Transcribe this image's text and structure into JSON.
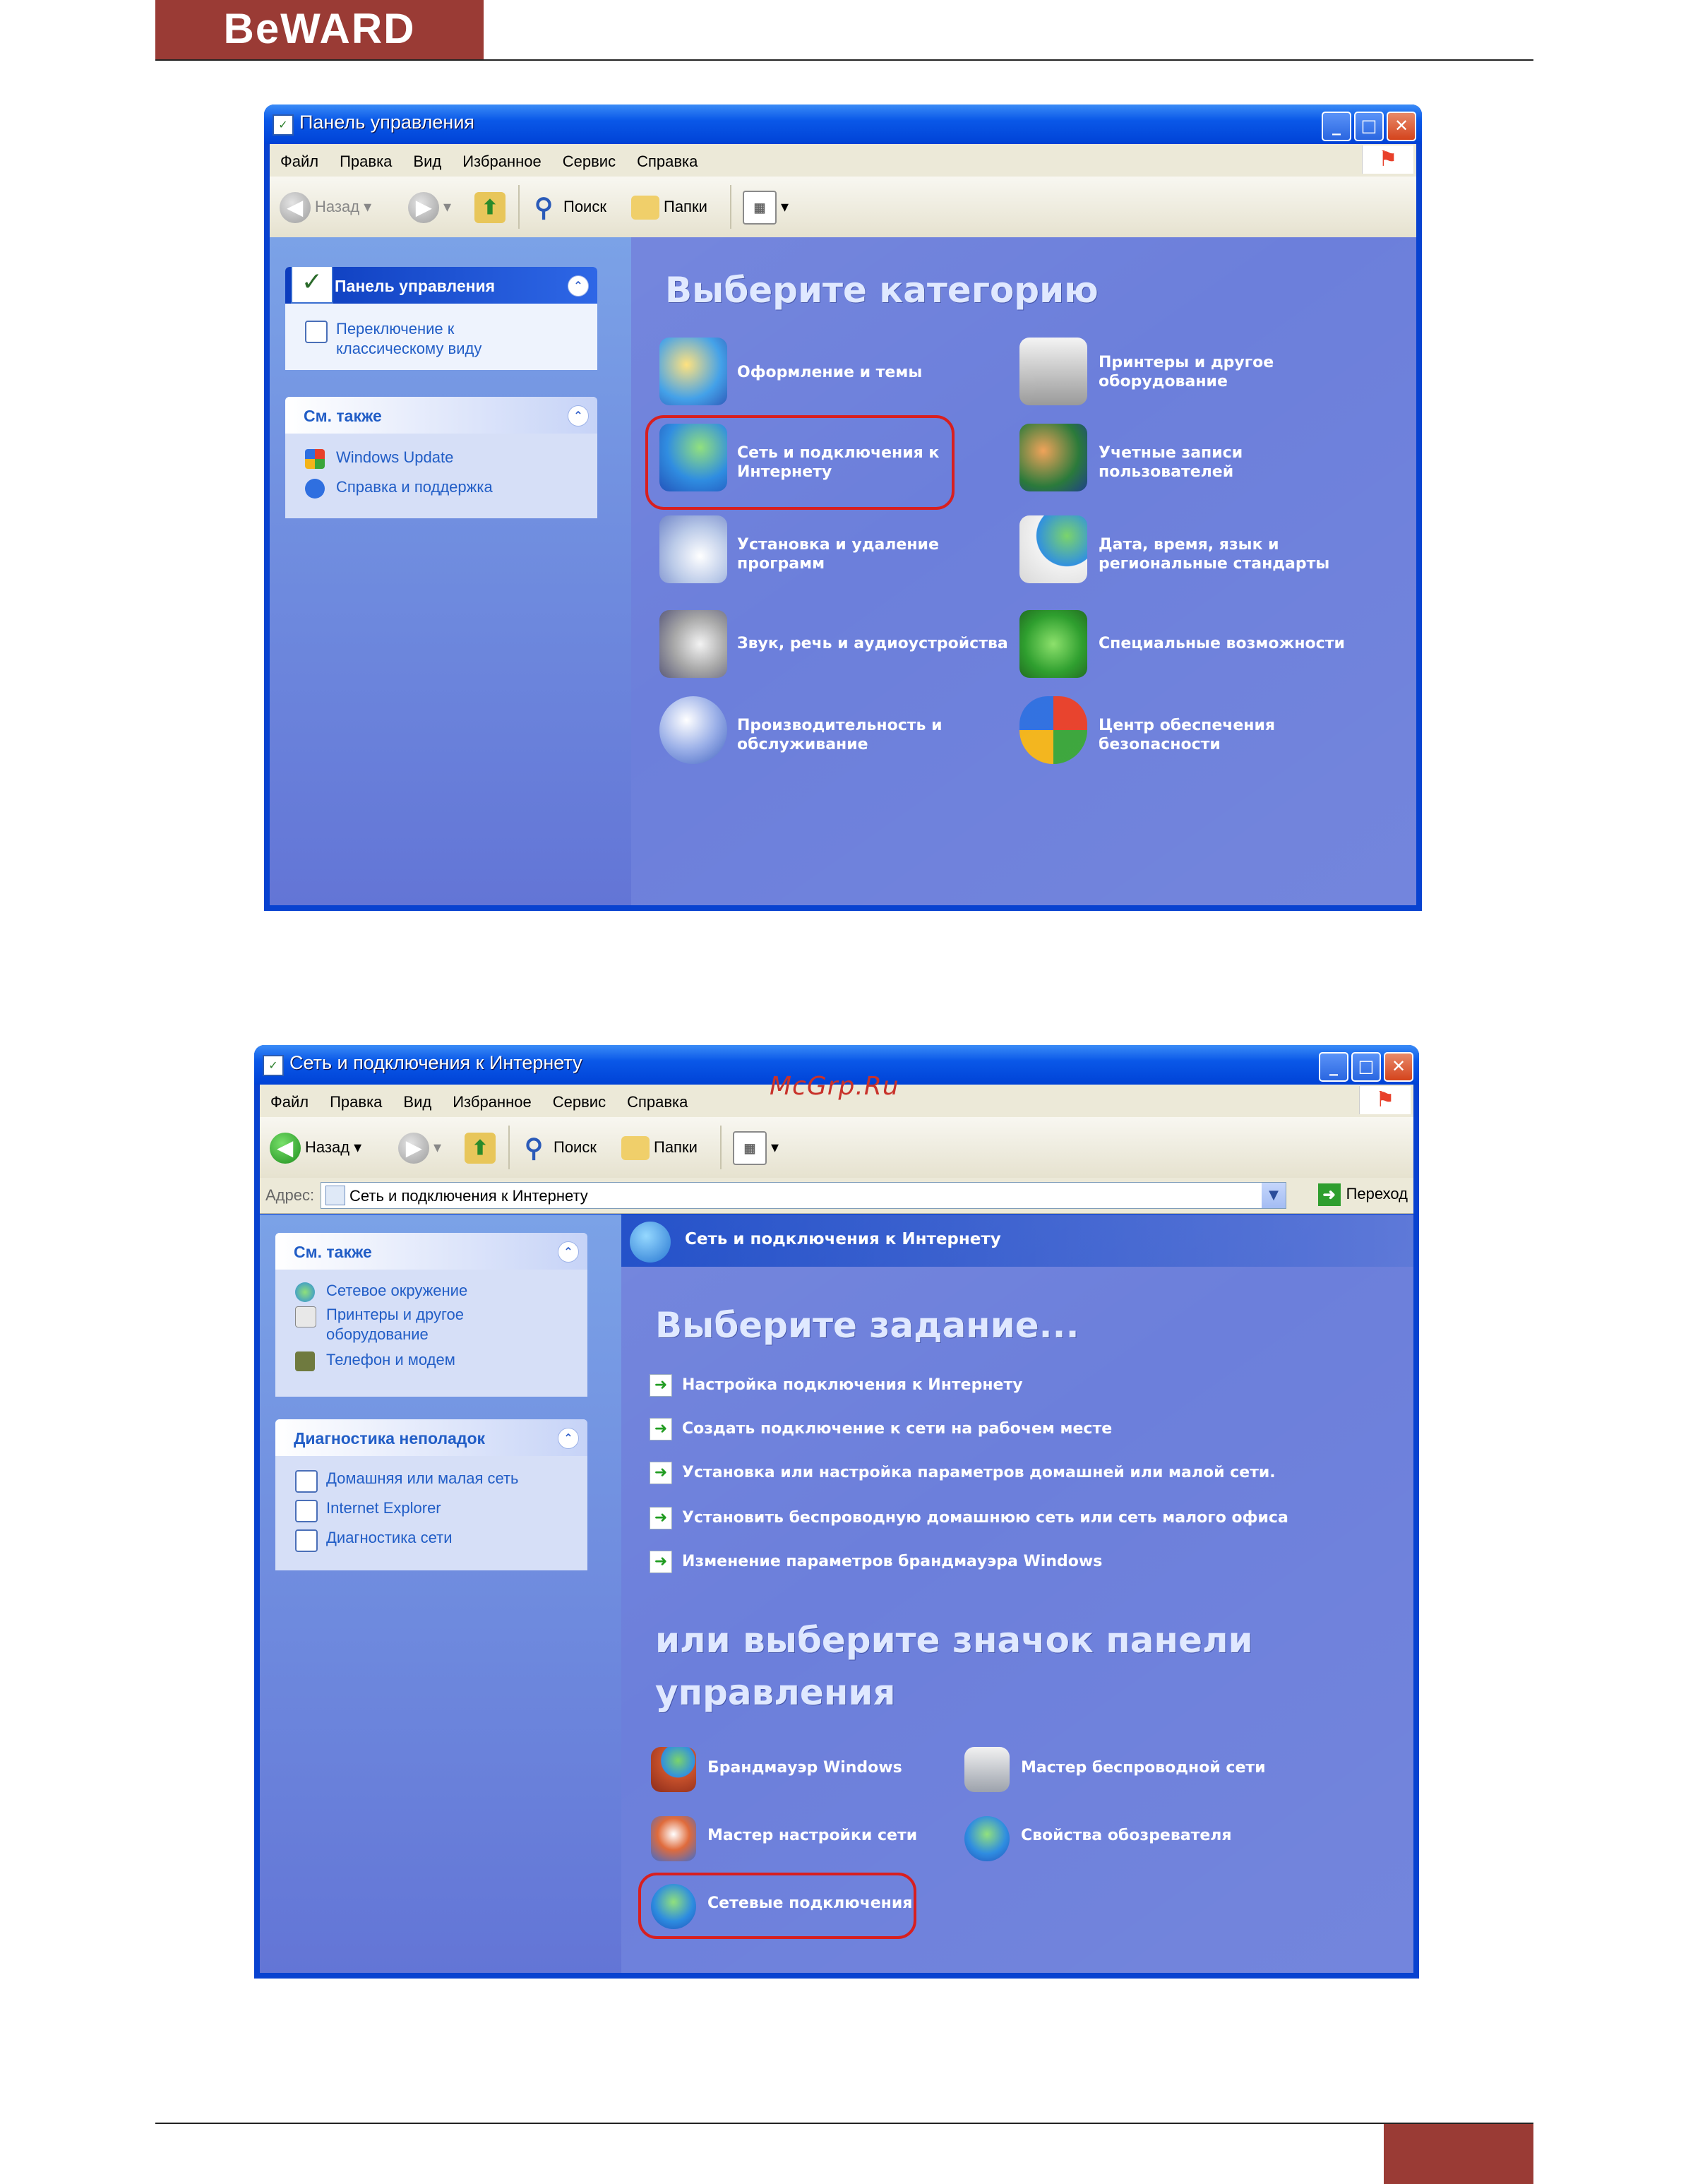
{
  "page": {
    "logo": "BeWARD",
    "watermark": "McGrp.Ru"
  },
  "icons": {
    "title": "control-panel-icon",
    "xp": "windows-flag-icon",
    "back": "back-arrow-icon",
    "forward": "forward-arrow-icon",
    "up": "folder-up-icon",
    "search": "magnifier-icon",
    "folders": "folders-icon",
    "views": "views-icon"
  },
  "window1": {
    "title": "Панель управления",
    "menu": [
      "Файл",
      "Правка",
      "Вид",
      "Избранное",
      "Сервис",
      "Справка"
    ],
    "toolbar": {
      "back": "Назад",
      "search": "Поиск",
      "folders": "Папки"
    },
    "sidebar": {
      "panel_title": "Панель управления",
      "switch_view": "Переключение к классическому виду",
      "see_also": "См. также",
      "links": [
        "Windows Update",
        "Справка и поддержка"
      ]
    },
    "heading": "Выберите категорию",
    "categories": [
      "Оформление и темы",
      "Принтеры и другое оборудование",
      "Сеть и подключения к Интернету",
      "Учетные записи пользователей",
      "Установка и удаление программ",
      "Дата, время, язык и региональные стандарты",
      "Звук, речь и аудиоустройства",
      "Специальные возможности",
      "Производительность и обслуживание",
      "Центр обеспечения безопасности"
    ]
  },
  "window2": {
    "title": "Сеть и подключения к Интернету",
    "menu": [
      "Файл",
      "Правка",
      "Вид",
      "Избранное",
      "Сервис",
      "Справка"
    ],
    "toolbar": {
      "back": "Назад",
      "search": "Поиск",
      "folders": "Папки"
    },
    "address": {
      "label": "Адрес:",
      "value": "Сеть и подключения к Интернету",
      "go": "Переход"
    },
    "breadcrumb": "Сеть и подключения к Интернету",
    "sidebar": {
      "see_also": "См. также",
      "see_also_links": [
        "Сетевое окружение",
        "Принтеры и другое оборудование",
        "Телефон и модем"
      ],
      "troubleshoot": "Диагностика неполадок",
      "troubleshoot_links": [
        "Домашняя или малая сеть",
        "Internet Explorer",
        "Диагностика сети"
      ]
    },
    "task_heading": "Выберите задание...",
    "tasks": [
      "Настройка подключения к Интернету",
      "Создать подключение к сети на рабочем месте",
      "Установка или настройка параметров домашней или малой сети.",
      "Установить беспроводную домашнюю сеть или сеть малого офиса",
      "Изменение параметров брандмауэра Windows"
    ],
    "icon_heading_1": "или выберите значок панели",
    "icon_heading_2": "управления",
    "panel_icons": [
      "Брандмауэр Windows",
      "Мастер беспроводной сети",
      "Мастер настройки сети",
      "Свойства обозревателя",
      "Сетевые подключения"
    ]
  },
  "colors": {
    "brand": "#9a3b35",
    "highlight": "#d81f1f",
    "xp_blue": "#0842d0"
  }
}
